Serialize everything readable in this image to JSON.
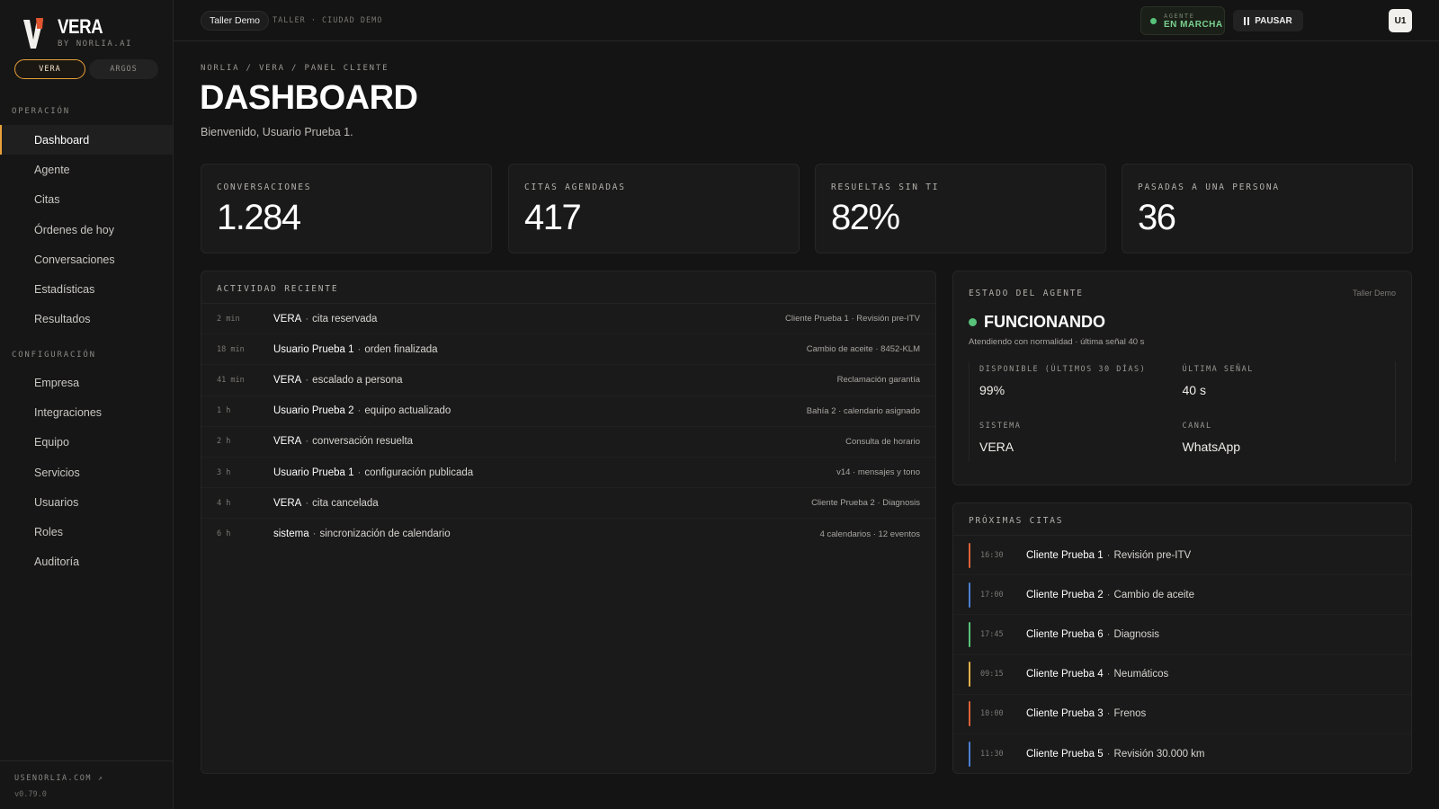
{
  "brand": {
    "name": "VERA",
    "by": "BY NORLIA.AI"
  },
  "product_switch": {
    "active": "VERA",
    "inactive": "ARGOS"
  },
  "sidebar": {
    "section_operation": "OPERACIÓN",
    "operation_items": [
      {
        "label": "Dashboard",
        "name": "sidebar-item-dashboard",
        "active": true
      },
      {
        "label": "Agente",
        "name": "sidebar-item-agente"
      },
      {
        "label": "Citas",
        "name": "sidebar-item-citas"
      },
      {
        "label": "Órdenes de hoy",
        "name": "sidebar-item-ordenes"
      },
      {
        "label": "Conversaciones",
        "name": "sidebar-item-conversaciones"
      },
      {
        "label": "Estadísticas",
        "name": "sidebar-item-estadisticas"
      },
      {
        "label": "Resultados",
        "name": "sidebar-item-resultados"
      }
    ],
    "section_config": "CONFIGURACIÓN",
    "config_items": [
      {
        "label": "Empresa",
        "name": "sidebar-item-empresa"
      },
      {
        "label": "Integraciones",
        "name": "sidebar-item-integraciones"
      },
      {
        "label": "Equipo",
        "name": "sidebar-item-equipo"
      },
      {
        "label": "Servicios",
        "name": "sidebar-item-servicios"
      },
      {
        "label": "Usuarios",
        "name": "sidebar-item-usuarios"
      },
      {
        "label": "Roles",
        "name": "sidebar-item-roles"
      },
      {
        "label": "Auditoría",
        "name": "sidebar-item-auditoria"
      }
    ],
    "footer_link": "USENORLIA.COM ↗",
    "version": "v0.79.0"
  },
  "topbar": {
    "shop_chip": "Taller Demo",
    "meta": "TALLER · CIUDAD DEMO",
    "agent_small": "AGENTE",
    "agent_status": "EN MARCHA",
    "pause_label": "PAUSAR",
    "avatar": "U1"
  },
  "header": {
    "breadcrumb": "NORLIA / VERA / PANEL CLIENTE",
    "title": "DASHBOARD",
    "welcome": "Bienvenido, Usuario Prueba 1."
  },
  "kpis": [
    {
      "label": "CONVERSACIONES",
      "value": "1.284"
    },
    {
      "label": "CITAS AGENDADAS",
      "value": "417"
    },
    {
      "label": "RESUELTAS SIN TI",
      "value": "82%"
    },
    {
      "label": "PASADAS A UNA PERSONA",
      "value": "36"
    }
  ],
  "activity": {
    "title": "ACTIVIDAD RECIENTE",
    "rows": [
      {
        "time": "2 min",
        "who": "VERA",
        "what": "cita reservada",
        "detail": "Cliente Prueba 1 · Revisión pre-ITV"
      },
      {
        "time": "18 min",
        "who": "Usuario Prueba 1",
        "what": "orden finalizada",
        "detail": "Cambio de aceite · 8452-KLM"
      },
      {
        "time": "41 min",
        "who": "VERA",
        "what": "escalado a persona",
        "detail": "Reclamación garantía"
      },
      {
        "time": "1 h",
        "who": "Usuario Prueba 2",
        "what": "equipo actualizado",
        "detail": "Bahía 2 · calendario asignado"
      },
      {
        "time": "2 h",
        "who": "VERA",
        "what": "conversación resuelta",
        "detail": "Consulta de horario"
      },
      {
        "time": "3 h",
        "who": "Usuario Prueba 1",
        "what": "configuración publicada",
        "detail": "v14 · mensajes y tono"
      },
      {
        "time": "4 h",
        "who": "VERA",
        "what": "cita cancelada",
        "detail": "Cliente Prueba 2 · Diagnosis"
      },
      {
        "time": "6 h",
        "who": "sistema",
        "what": "sincronización de calendario",
        "detail": "4 calendarios · 12 eventos"
      }
    ]
  },
  "agent_state": {
    "title": "ESTADO DEL AGENTE",
    "shop": "Taller Demo",
    "status": "FUNCIONANDO",
    "subtitle": "Atendiendo con normalidad · última señal 40 s",
    "metrics": [
      {
        "label": "DISPONIBLE (ÚLTIMOS 30 DÍAS)",
        "value": "99%"
      },
      {
        "label": "ÚLTIMA SEÑAL",
        "value": "40 s"
      },
      {
        "label": "SISTEMA",
        "value": "VERA"
      },
      {
        "label": "CANAL",
        "value": "WhatsApp"
      }
    ]
  },
  "upcoming": {
    "title": "PRÓXIMAS CITAS",
    "items": [
      {
        "time": "16:30",
        "client": "Cliente Prueba 1",
        "service": "Revisión pre-ITV",
        "color": "#d9623b"
      },
      {
        "time": "17:00",
        "client": "Cliente Prueba 2",
        "service": "Cambio de aceite",
        "color": "#4a7fd1"
      },
      {
        "time": "17:45",
        "client": "Cliente Prueba 6",
        "service": "Diagnosis",
        "color": "#58c27a"
      },
      {
        "time": "09:15",
        "client": "Cliente Prueba 4",
        "service": "Neumáticos",
        "color": "#e0b14a"
      },
      {
        "time": "10:00",
        "client": "Cliente Prueba 3",
        "service": "Frenos",
        "color": "#d9623b"
      },
      {
        "time": "11:30",
        "client": "Cliente Prueba 5",
        "service": "Revisión 30.000 km",
        "color": "#4a7fd1"
      }
    ]
  },
  "colors": {
    "accent": "#e8a13a",
    "ok": "#58c27a",
    "bg": "#141414",
    "panel": "#1a1a1a"
  }
}
